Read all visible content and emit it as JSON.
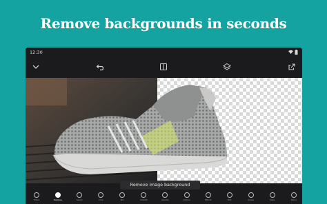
{
  "headline": "Remove backgrounds in seconds",
  "statusbar": {
    "time": "12:30"
  },
  "toolbar": {
    "icons": [
      "chevron-down-icon",
      "undo-icon",
      "compare-icon",
      "layers-icon",
      "export-icon"
    ]
  },
  "canvas": {
    "split_label": ""
  },
  "action": {
    "remove_bg_label": "Remove image background"
  },
  "tools": [
    {
      "label": "Filters",
      "icon": "filters-icon"
    },
    {
      "label": "Remove",
      "icon": "remove-bg-icon",
      "active": true
    },
    {
      "label": "Select",
      "icon": "select-icon"
    },
    {
      "label": "Crop",
      "icon": "crop-icon"
    },
    {
      "label": "Mix",
      "icon": "mix-icon"
    },
    {
      "label": "Smooth",
      "icon": "smooth-icon"
    },
    {
      "label": "Opacity",
      "icon": "opacity-icon"
    },
    {
      "label": "Outline",
      "icon": "outline-icon"
    },
    {
      "label": "Effects",
      "icon": "effects-icon"
    },
    {
      "label": "Text",
      "icon": "text-icon"
    },
    {
      "label": "Shape",
      "icon": "shape-icon"
    },
    {
      "label": "Mask",
      "icon": "mask-icon"
    },
    {
      "label": "Blend",
      "icon": "blend-icon"
    }
  ],
  "colors": {
    "background": "#14a3a0",
    "device": "#1b1b1d",
    "shoe_gray": "#a9abaa",
    "accent_yellow": "#d6e86a"
  }
}
